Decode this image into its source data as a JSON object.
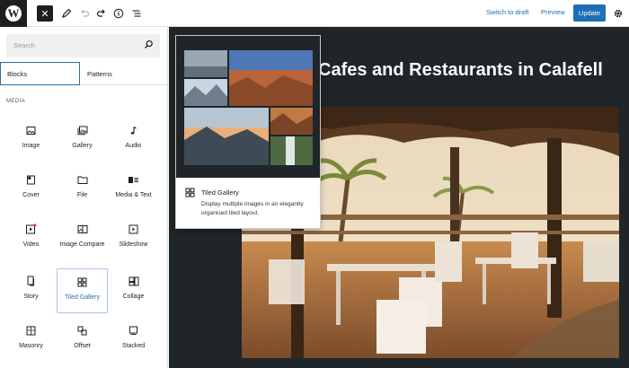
{
  "topbar": {
    "logo_letter": "W",
    "close_symbol": "✕",
    "switch_to_draft": "Switch to draft",
    "preview": "Preview",
    "update": "Update"
  },
  "inserter": {
    "search_placeholder": "Search",
    "tabs": [
      {
        "label": "Blocks",
        "active": true
      },
      {
        "label": "Patterns",
        "active": false
      }
    ],
    "category": "MEDIA",
    "blocks": [
      {
        "label": "Image",
        "icon": "image-icon"
      },
      {
        "label": "Gallery",
        "icon": "gallery-icon"
      },
      {
        "label": "Audio",
        "icon": "audio-icon"
      },
      {
        "label": "Cover",
        "icon": "cover-icon"
      },
      {
        "label": "File",
        "icon": "file-icon"
      },
      {
        "label": "Media & Text",
        "icon": "media-text-icon"
      },
      {
        "label": "Video",
        "icon": "video-icon"
      },
      {
        "label": "Image Compare",
        "icon": "image-compare-icon"
      },
      {
        "label": "Slideshow",
        "icon": "slideshow-icon"
      },
      {
        "label": "Story",
        "icon": "story-icon"
      },
      {
        "label": "Tiled Gallery",
        "icon": "tiled-gallery-icon",
        "selected": true
      },
      {
        "label": "Collage",
        "icon": "collage-icon"
      },
      {
        "label": "Masonry",
        "icon": "masonry-icon"
      },
      {
        "label": "Offset",
        "icon": "offset-icon"
      },
      {
        "label": "Stacked",
        "icon": "stacked-icon"
      }
    ]
  },
  "popover": {
    "title": "Tiled Gallery",
    "description": "Display multiple images in an elegantly organised tiled layout."
  },
  "canvas": {
    "post_title": "Cafes and Restaurants in Calafell"
  },
  "colors": {
    "accent": "#2271b1",
    "update_button": "#1e6fb5",
    "canvas_bg": "#1f2528"
  }
}
